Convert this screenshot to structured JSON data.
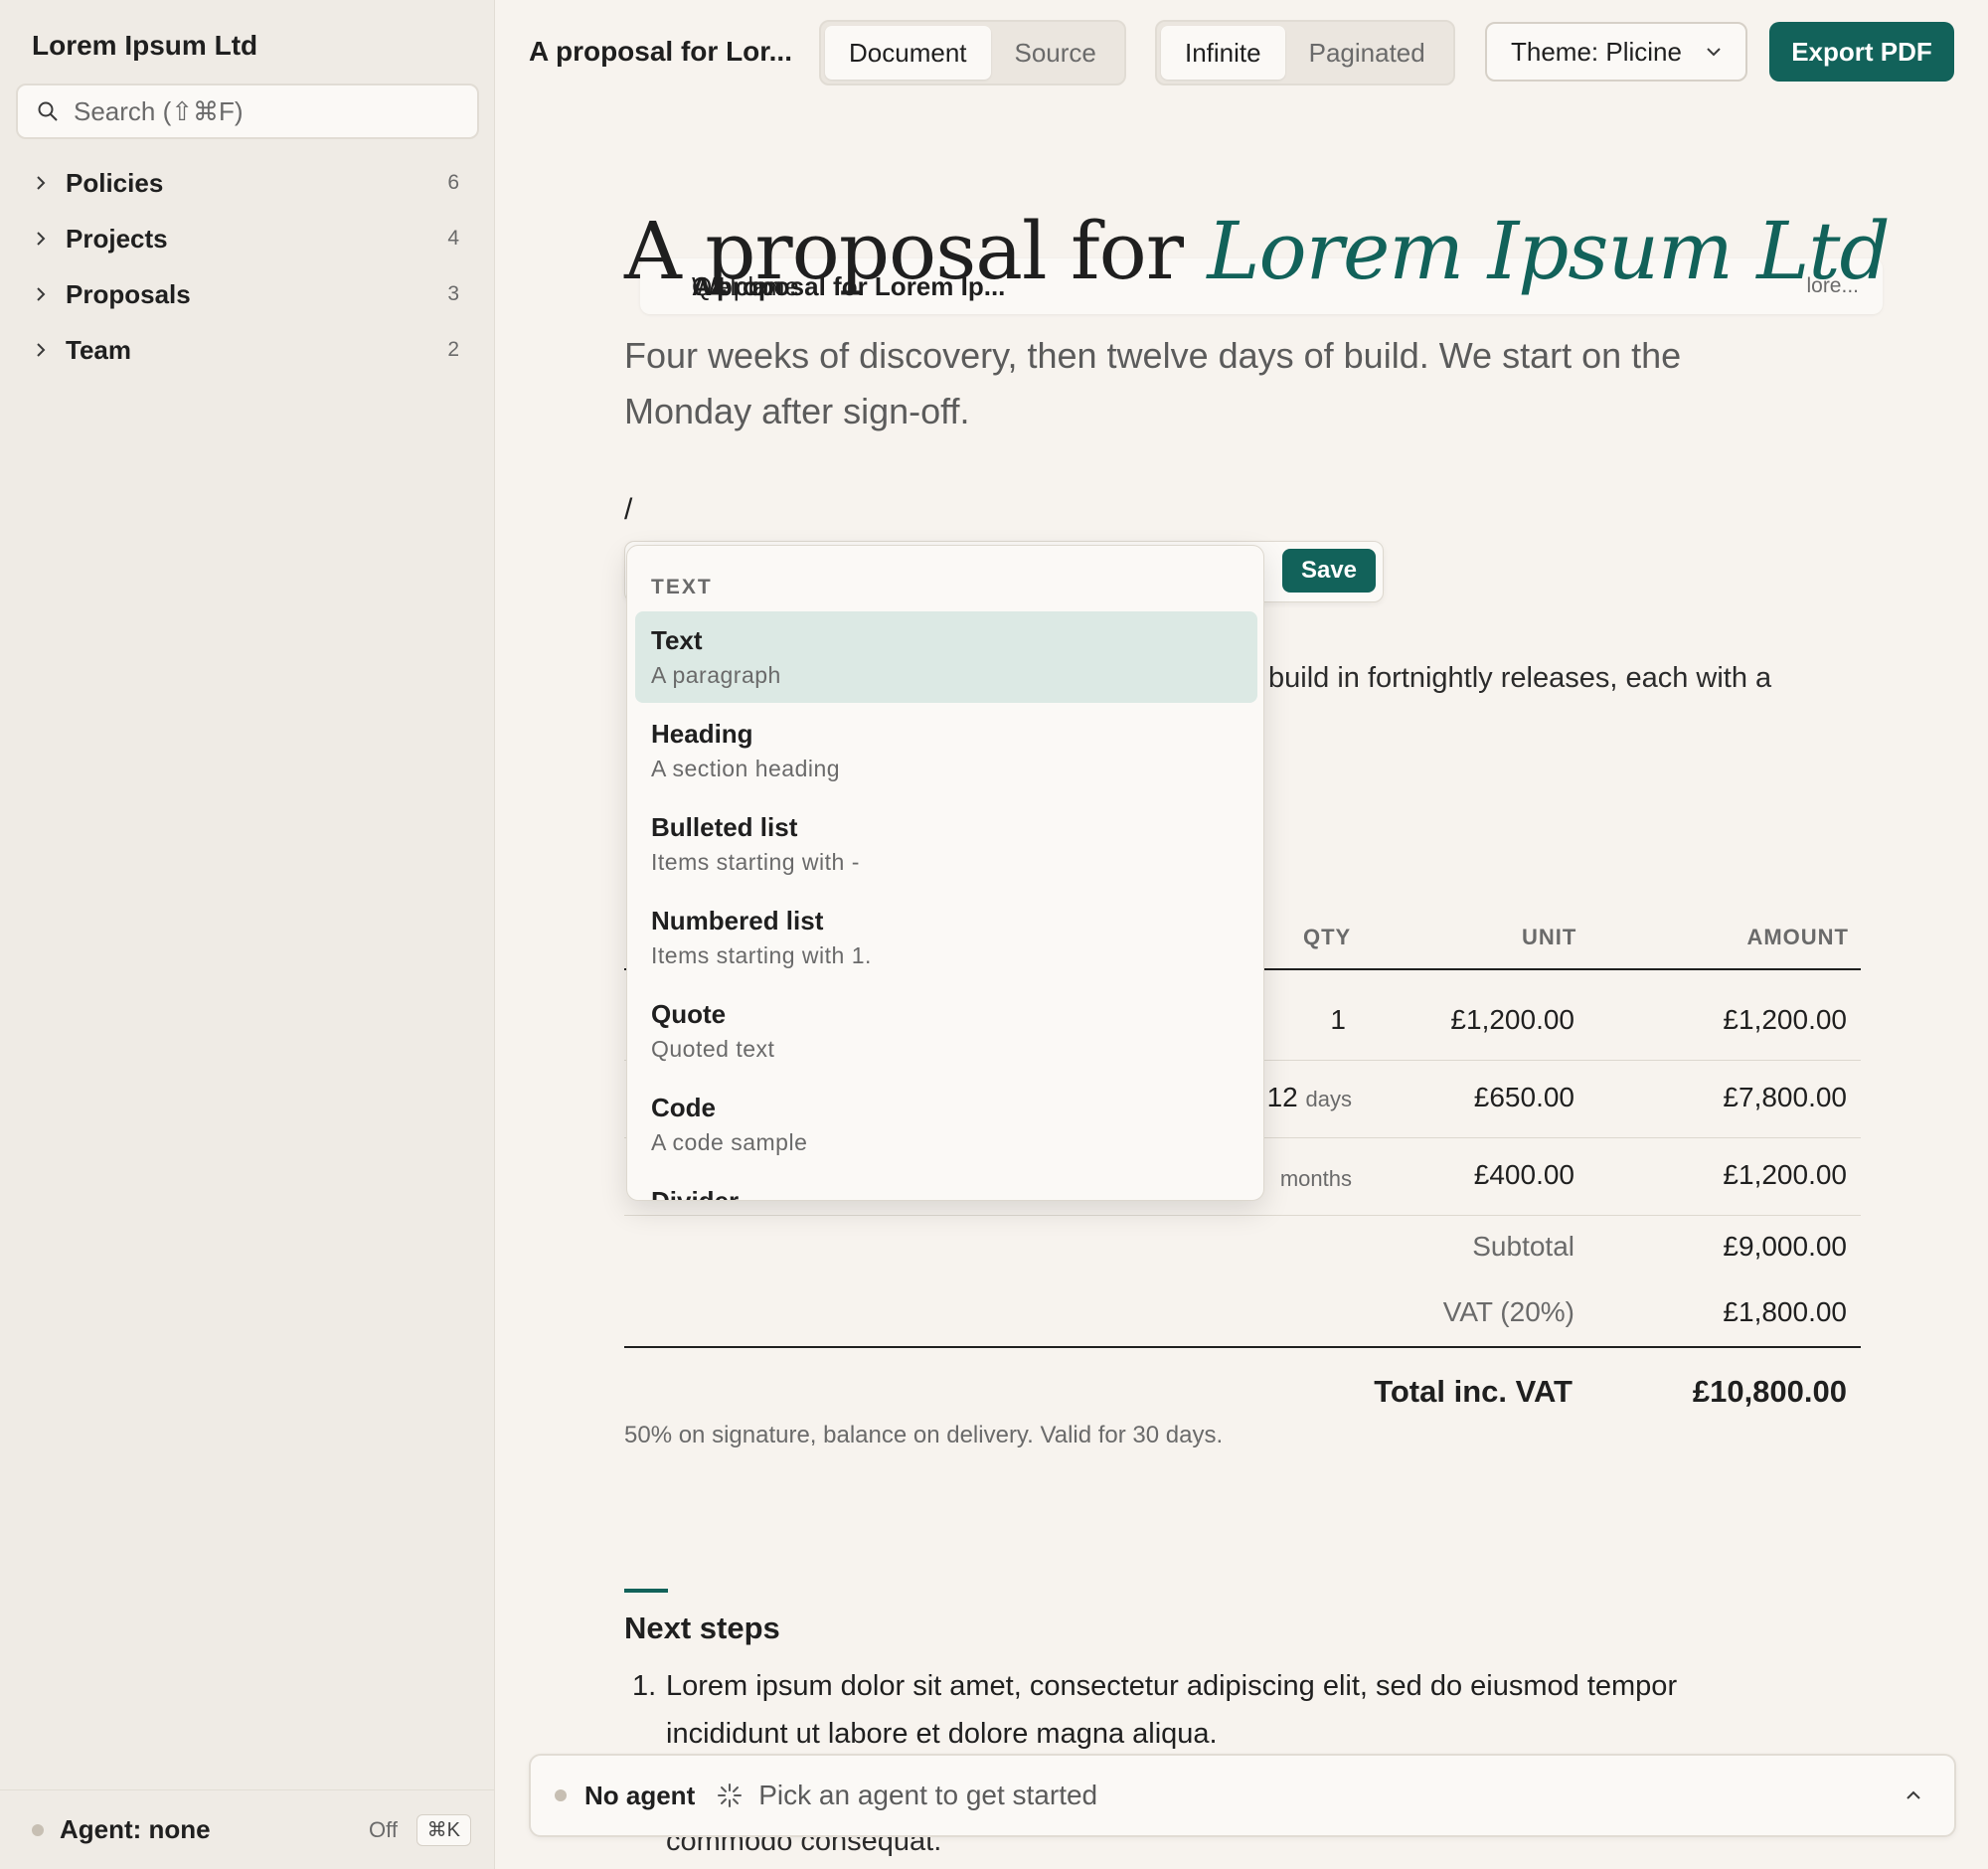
{
  "sidebar": {
    "workspace": "Lorem Ipsum Ltd",
    "search_placeholder": "Search (⇧⌘F)",
    "groups": [
      {
        "label": "Policies",
        "count": "6"
      },
      {
        "label": "Projects",
        "count": "4"
      },
      {
        "label": "Proposals",
        "count": "3"
      },
      {
        "label": "Team",
        "count": "2"
      }
    ],
    "docs": [
      {
        "label": "A proposal for Lorem Ip...",
        "slug": "lore..."
      },
      {
        "label": "Q4 plan"
      },
      {
        "label": "Welcome"
      }
    ],
    "footer": {
      "agent": "Agent: none",
      "status": "Off",
      "shortcut": "⌘K"
    }
  },
  "toolbar": {
    "title": "A proposal for Lor...",
    "view_modes": [
      "Document",
      "Source"
    ],
    "layout_modes": [
      "Infinite",
      "Paginated"
    ],
    "theme": "Theme: Plicine",
    "export": "Export PDF"
  },
  "document": {
    "heading_plain": "A proposal for ",
    "heading_accent": "Lorem Ipsum Ltd",
    "lead": "Four weeks of discovery, then twelve days of build. We start on the Monday after sign-off.",
    "slash": "/",
    "para_fragment": "build in fortnightly releases, each with a",
    "table": {
      "headers": [
        "QTY",
        "UNIT",
        "AMOUNT"
      ],
      "rows": [
        {
          "qty": "1",
          "qty_unit": "",
          "unit": "£1,200.00",
          "amount": "£1,200.00"
        },
        {
          "qty": "12",
          "qty_unit": "days",
          "unit": "£650.00",
          "amount": "£7,800.00"
        },
        {
          "qty": "",
          "qty_unit": "months",
          "unit": "£400.00",
          "amount": "£1,200.00"
        }
      ],
      "subtotal_label": "Subtotal",
      "subtotal": "£9,000.00",
      "vat_label": "VAT (20%)",
      "vat": "£1,800.00",
      "total_label": "Total inc. VAT",
      "total": "£10,800.00"
    },
    "terms": "50% on signature, balance on delivery. Valid for 30 days.",
    "next_steps_title": "Next steps",
    "next_steps": [
      {
        "num": "1.",
        "text": "Lorem ipsum dolor sit amet, consectetur adipiscing elit, sed do eiusmod tempor incididunt ut labore et dolore magna aliqua."
      }
    ],
    "hidden_line": "commodo consequat."
  },
  "slash_menu": {
    "save": "Save",
    "section": "TEXT",
    "items": [
      {
        "title": "Text",
        "desc": "A paragraph"
      },
      {
        "title": "Heading",
        "desc": "A section heading"
      },
      {
        "title": "Bulleted list",
        "desc": "Items starting with -"
      },
      {
        "title": "Numbered list",
        "desc": "Items starting with 1."
      },
      {
        "title": "Quote",
        "desc": "Quoted text"
      },
      {
        "title": "Code",
        "desc": "A code sample"
      },
      {
        "title": "Divider",
        "desc": ""
      }
    ]
  },
  "agent_bar": {
    "name": "No agent",
    "hint": "Pick an agent to get started"
  },
  "colors": {
    "accent": "#12625a",
    "background": "#f7f3ee",
    "sidebar": "#efebe5",
    "selected_item": "#dce9e4"
  }
}
